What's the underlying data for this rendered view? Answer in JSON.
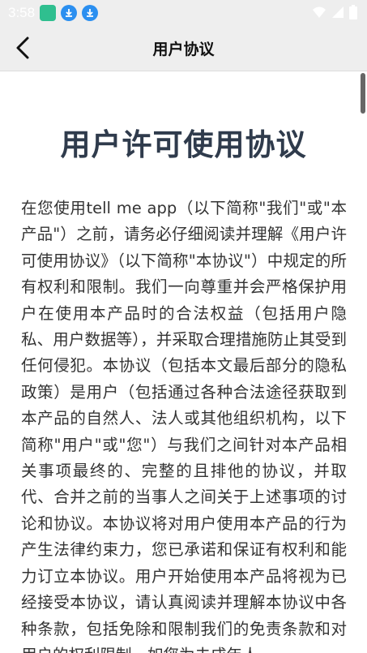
{
  "status_bar": {
    "time": "3:58",
    "icons": [
      "app-notification-icon",
      "download-icon",
      "download-icon",
      "wifi-icon",
      "signal-icon",
      "battery-icon"
    ]
  },
  "header": {
    "title": "用户协议",
    "back_icon": "chevron-left-icon"
  },
  "document": {
    "title": "用户许可使用协议",
    "body": "在您使用tell me app（以下简称\"我们\"或\"本产品\"）之前，请务必仔细阅读并理解《用户许可使用协议》（以下简称\"本协议\"）中规定的所有权利和限制。我们一向尊重并会严格保护用户在使用本产品时的合法权益（包括用户隐私、用户数据等），并采取合理措施防止其受到任何侵犯。本协议（包括本文最后部分的隐私政策）是用户（包括通过各种合法途径获取到本产品的自然人、法人或其他组织机构，以下简称\"用户\"或\"您\"）与我们之间针对本产品相关事项最终的、完整的且排他的协议，并取代、合并之前的当事人之间关于上述事项的讨论和协议。本协议将对用户使用本产品的行为产生法律约束力，您已承诺和保证有权利和能力订立本协议。用户开始使用本产品将视为已经接受本协议，请认真阅读并理解本协议中各种条款，包括免除和限制我们的免责条款和对用户的权利限制。如您为未成年人"
  },
  "colors": {
    "header_bg": "#eeeeee",
    "title_color": "#2f3b4c",
    "accent": "#2b8ff0"
  }
}
